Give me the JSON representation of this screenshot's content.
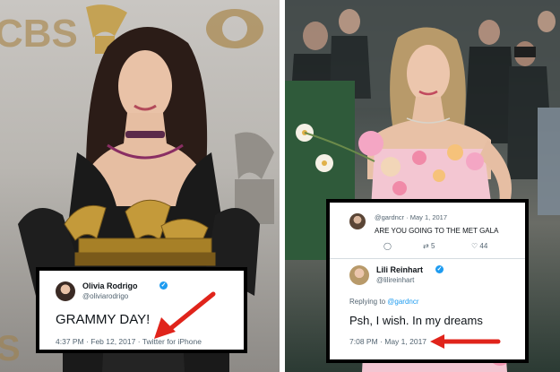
{
  "left_photo": {
    "backdrop_logo_text": "CBS",
    "colors": {
      "backdrop": "#c9c6c2",
      "dress": "#1a1a1a",
      "gold": "#c49a3a",
      "choker": "#5b2a4a"
    }
  },
  "right_photo": {
    "colors": {
      "background": "#3a4240",
      "dress": "#f3c6d2",
      "flowers": "#f4a6c4",
      "hedge": "#2f5a3a"
    }
  },
  "tweet_left": {
    "name": "Olivia Rodrigo",
    "handle": "@oliviarodrigo",
    "text": "GRAMMY DAY!",
    "time": "4:37 PM",
    "date": "Feb 12, 2017",
    "source": "Twitter for iPhone",
    "sep1": "·",
    "sep2": "·"
  },
  "tweet_right": {
    "reply_author": {
      "handle": "@gardncr",
      "date": "May 1, 2017",
      "sep": "·",
      "text": "ARE YOU GOING TO THE MET GALA",
      "retweets": "5",
      "likes": "44"
    },
    "main": {
      "name": "Lili Reinhart",
      "handle": "@lilireinhart",
      "replying_prefix": "Replying to",
      "replying_handle": "@gardncr",
      "text": "Psh, I wish. In my dreams",
      "time": "7:08 PM",
      "sep": "·",
      "date": "May 1, 2017"
    }
  },
  "colors": {
    "verified": "#1d9bf0",
    "arrow": "#e0241b",
    "link": "#1d9bf0"
  }
}
